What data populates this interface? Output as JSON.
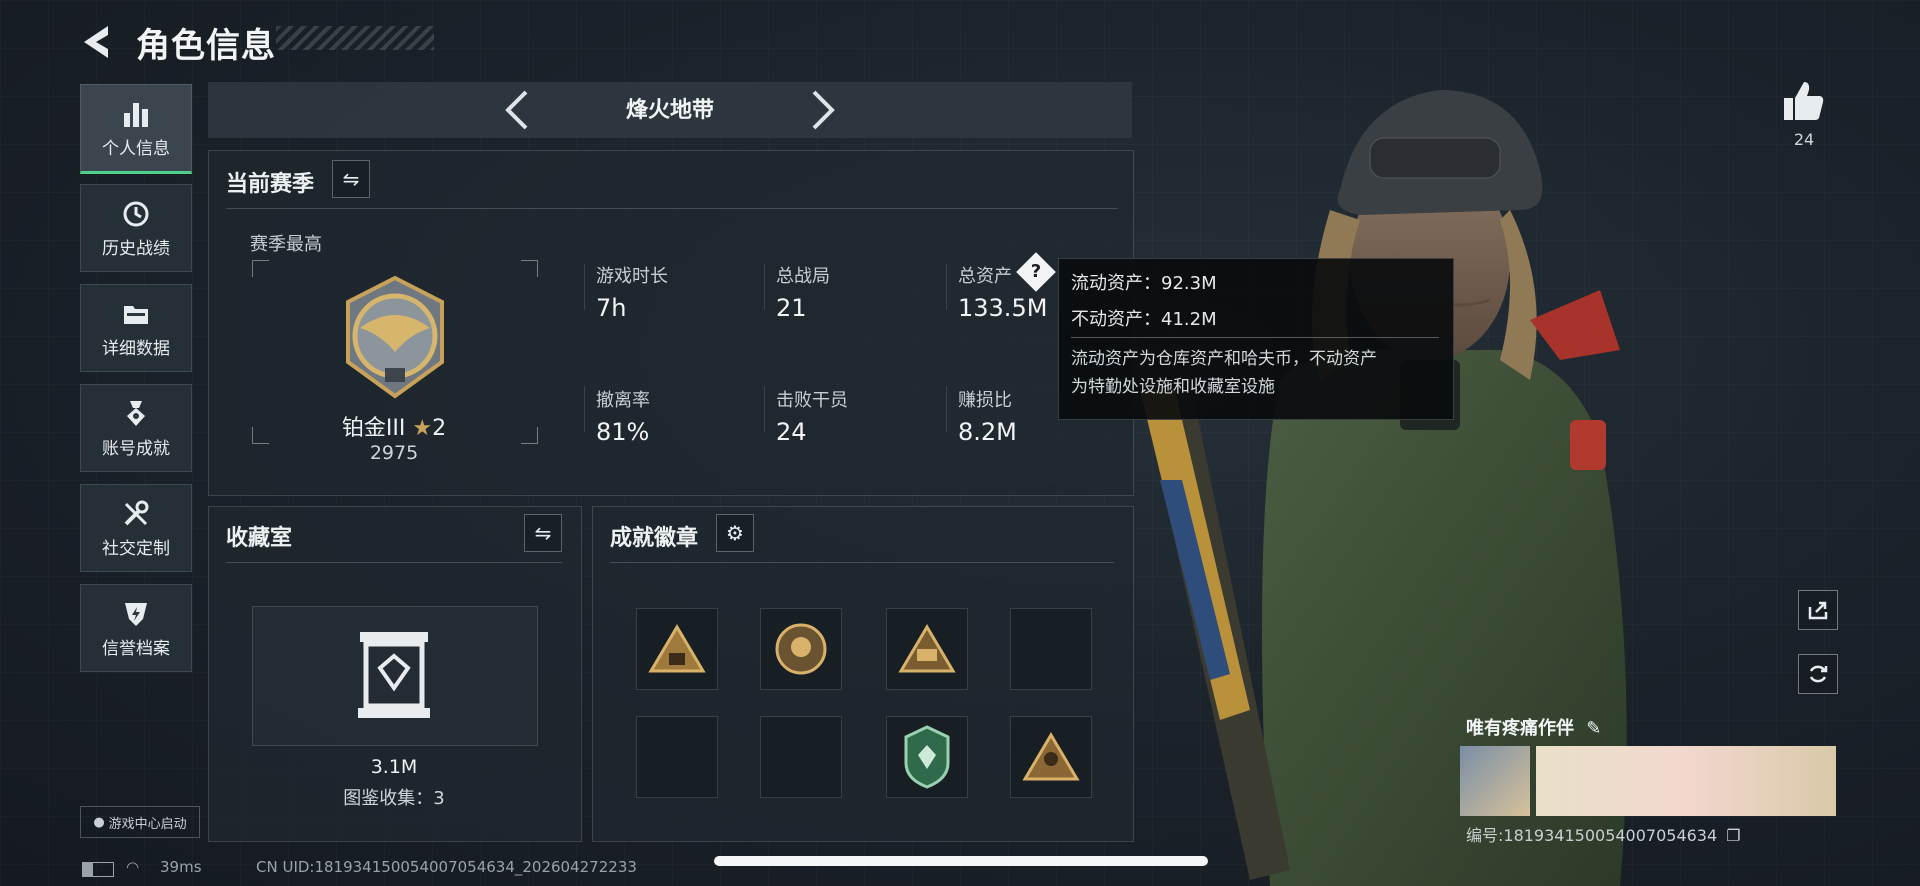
{
  "header": {
    "title": "角色信息"
  },
  "sidebar": {
    "items": [
      {
        "label": "个人信息",
        "icon": "bar-chart-icon",
        "active": true
      },
      {
        "label": "历史战绩",
        "icon": "history-clock-icon",
        "active": false
      },
      {
        "label": "详细数据",
        "icon": "folder-data-icon",
        "active": false
      },
      {
        "label": "账号成就",
        "icon": "achievement-medal-icon",
        "active": false
      },
      {
        "label": "社交定制",
        "icon": "tools-icon",
        "active": false
      },
      {
        "label": "信誉档案",
        "icon": "reputation-shield-icon",
        "active": false
      }
    ],
    "launch_badge": "游戏中心启动"
  },
  "mode": {
    "title": "烽火地带"
  },
  "season": {
    "title": "当前赛季",
    "best_label": "赛季最高",
    "rank_name": "铂金III",
    "rank_stars": "2",
    "rank_points": "2975",
    "stats": [
      {
        "label": "游戏时长",
        "value": "7h"
      },
      {
        "label": "总战局",
        "value": "21"
      },
      {
        "label": "总资产",
        "value": "133.5M"
      },
      {
        "label": "撤离率",
        "value": "81%"
      },
      {
        "label": "击败干员",
        "value": "24"
      },
      {
        "label": "赚损比",
        "value": "8.2M"
      }
    ]
  },
  "tooltip": {
    "liquid": "流动资产：92.3M",
    "fixed": "不动资产：41.2M",
    "desc1": "流动资产为仓库资产和哈夫币，不动资产",
    "desc2": "为特勤处设施和收藏室设施"
  },
  "collection": {
    "title": "收藏室",
    "value": "3.1M",
    "collected": "图鉴收集：3"
  },
  "achievements": {
    "title": "成就徽章"
  },
  "right": {
    "likes": "24",
    "title_name": "唯有疼痛作伴",
    "serial": "编号:18193415005400705463​4"
  },
  "status": {
    "ping": "39ms",
    "uid": "CN UID:181934150054007054634_202604272233"
  },
  "colors": {
    "accent_active": "#4fd08a",
    "gold": "#c8a25a"
  }
}
